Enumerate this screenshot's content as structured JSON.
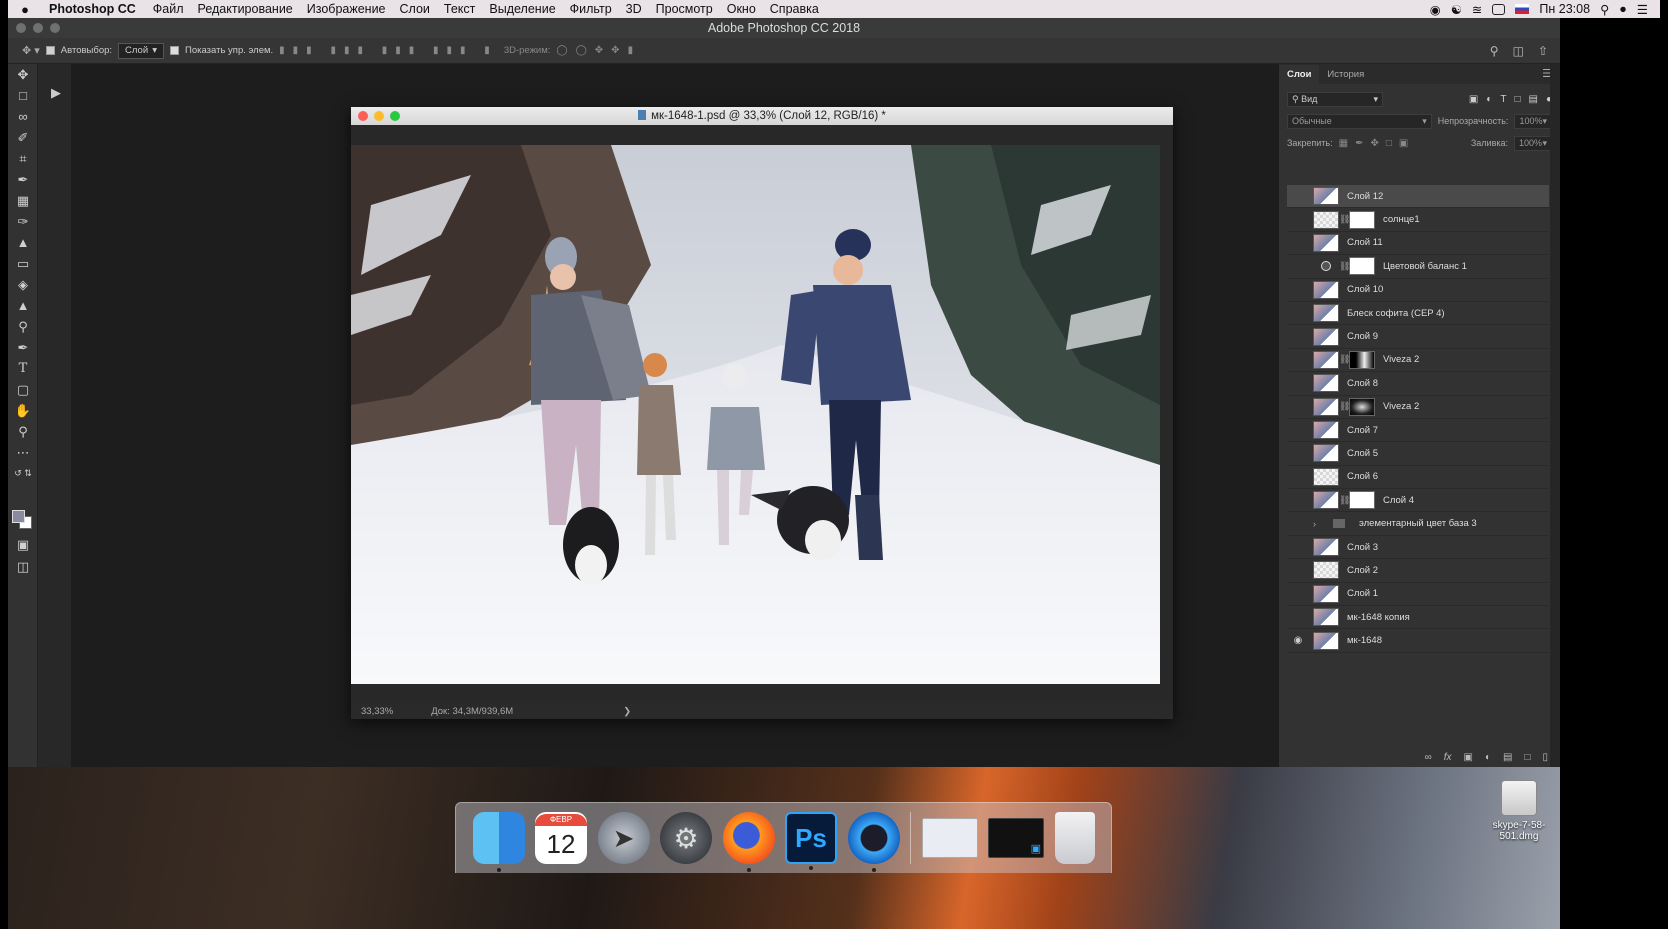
{
  "menubar": {
    "apple": "",
    "app_name": "Photoshop CC",
    "items": [
      "Файл",
      "Редактирование",
      "Изображение",
      "Слои",
      "Текст",
      "Выделение",
      "Фильтр",
      "3D",
      "Просмотр",
      "Окно",
      "Справка"
    ],
    "clock": "Пн 23:08"
  },
  "photoshop": {
    "window_title": "Adobe Photoshop CC 2018",
    "options": {
      "autoselect_label": "Автовыбор:",
      "autoselect_value": "Слой",
      "show_transform_label": "Показать упр. элем.",
      "mode3d_label": "3D-режим:"
    },
    "document": {
      "title": "мк-1648-1.psd @ 33,3% (Слой 12, RGB/16) *",
      "zoom": "33,33%",
      "doc_size": "Док: 34,3M/939,6M"
    },
    "panel": {
      "tabs": [
        "Слои",
        "История"
      ],
      "filter_value": "Вид",
      "blend_mode": "Обычные",
      "opacity_label": "Непрозрачность:",
      "opacity_value": "100%",
      "lock_label": "Закрепить:",
      "fill_label": "Заливка:",
      "fill_value": "100%",
      "layers": [
        {
          "name": "Слой 12",
          "thumb": "photo",
          "selected": true
        },
        {
          "name": "солнце1",
          "thumb": "checker",
          "mask": "white"
        },
        {
          "name": "Слой 11",
          "thumb": "photo"
        },
        {
          "name": "Цветовой баланс 1",
          "thumb": "adjustment",
          "mask": "white"
        },
        {
          "name": "Слой 10",
          "thumb": "photo"
        },
        {
          "name": "Блеск софита (CEP 4)",
          "thumb": "photo"
        },
        {
          "name": "Слой 9",
          "thumb": "photo"
        },
        {
          "name": "Viveza 2",
          "thumb": "photo",
          "mask": "dark"
        },
        {
          "name": "Слой 8",
          "thumb": "photo"
        },
        {
          "name": "Viveza 2",
          "thumb": "photo",
          "mask": "dark2"
        },
        {
          "name": "Слой 7",
          "thumb": "photo"
        },
        {
          "name": "Слой 5",
          "thumb": "photo"
        },
        {
          "name": "Слой 6",
          "thumb": "checker"
        },
        {
          "name": "Слой 4",
          "thumb": "photo",
          "mask": "white"
        },
        {
          "name": "элементарный цвет база 3",
          "thumb": "folder"
        },
        {
          "name": "Слой 3",
          "thumb": "photo"
        },
        {
          "name": "Слой 2",
          "thumb": "checker"
        },
        {
          "name": "Слой 1",
          "thumb": "photo"
        },
        {
          "name": "мк-1648 копия",
          "thumb": "photo"
        },
        {
          "name": "мк-1648",
          "thumb": "photo",
          "visible": true
        }
      ]
    }
  },
  "desktop": {
    "file_label": "skype-7-58-501.dmg",
    "dock": {
      "calendar_month": "ФЕВР",
      "calendar_day": "12",
      "ps_label": "Ps"
    }
  }
}
